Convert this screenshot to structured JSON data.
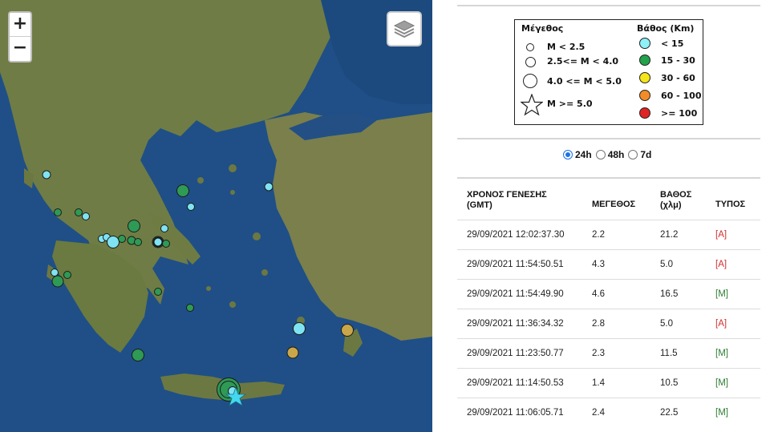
{
  "map": {
    "zoom_in_label": "+",
    "zoom_out_label": "−",
    "layers_icon": "layers-icon",
    "colors": {
      "sea": "#1f4f86",
      "land": "#6b7a44",
      "cyan": "#7fe3f2",
      "green": "#2e9a55",
      "gold": "#c9a64a"
    }
  },
  "legend": {
    "magnitude_title": "Μέγεθος",
    "depth_title": "Βάθος (Km)",
    "magnitude_items": [
      "M < 2.5",
      "2.5<= M < 4.0",
      "4.0 <= M < 5.0",
      "M >= 5.0"
    ],
    "depth_items": [
      {
        "label": "< 15",
        "color": "#8ff0f7"
      },
      {
        "label": "15 - 30",
        "color": "#22a24a"
      },
      {
        "label": "30 - 60",
        "color": "#f5e51b"
      },
      {
        "label": "60 - 100",
        "color": "#f28c28"
      },
      {
        "label": ">= 100",
        "color": "#e02424"
      }
    ]
  },
  "period": {
    "options": [
      "24h",
      "48h",
      "7d"
    ],
    "selected": "24h"
  },
  "table": {
    "headers": {
      "time": "ΧΡΟΝΟΣ ΓΕΝΕΣΗΣ",
      "time_sub": "(GMT)",
      "magnitude": "ΜΕΓΕΘΟΣ",
      "depth": "ΒΑΘΟΣ",
      "depth_sub": "(χλμ)",
      "type": "ΤΥΠΟΣ"
    },
    "rows": [
      {
        "time": "29/09/2021 12:02:37.30",
        "magnitude": "2.2",
        "depth": "21.2",
        "type": "[A]"
      },
      {
        "time": "29/09/2021 11:54:50.51",
        "magnitude": "4.3",
        "depth": "5.0",
        "type": "[A]"
      },
      {
        "time": "29/09/2021 11:54:49.90",
        "magnitude": "4.6",
        "depth": "16.5",
        "type": "[M]"
      },
      {
        "time": "29/09/2021 11:36:34.32",
        "magnitude": "2.8",
        "depth": "5.0",
        "type": "[A]"
      },
      {
        "time": "29/09/2021 11:23:50.77",
        "magnitude": "2.3",
        "depth": "11.5",
        "type": "[M]"
      },
      {
        "time": "29/09/2021 11:14:50.53",
        "magnitude": "1.4",
        "depth": "10.5",
        "type": "[M]"
      },
      {
        "time": "29/09/2021 11:06:05.71",
        "magnitude": "2.4",
        "depth": "22.5",
        "type": "[M]"
      }
    ]
  }
}
